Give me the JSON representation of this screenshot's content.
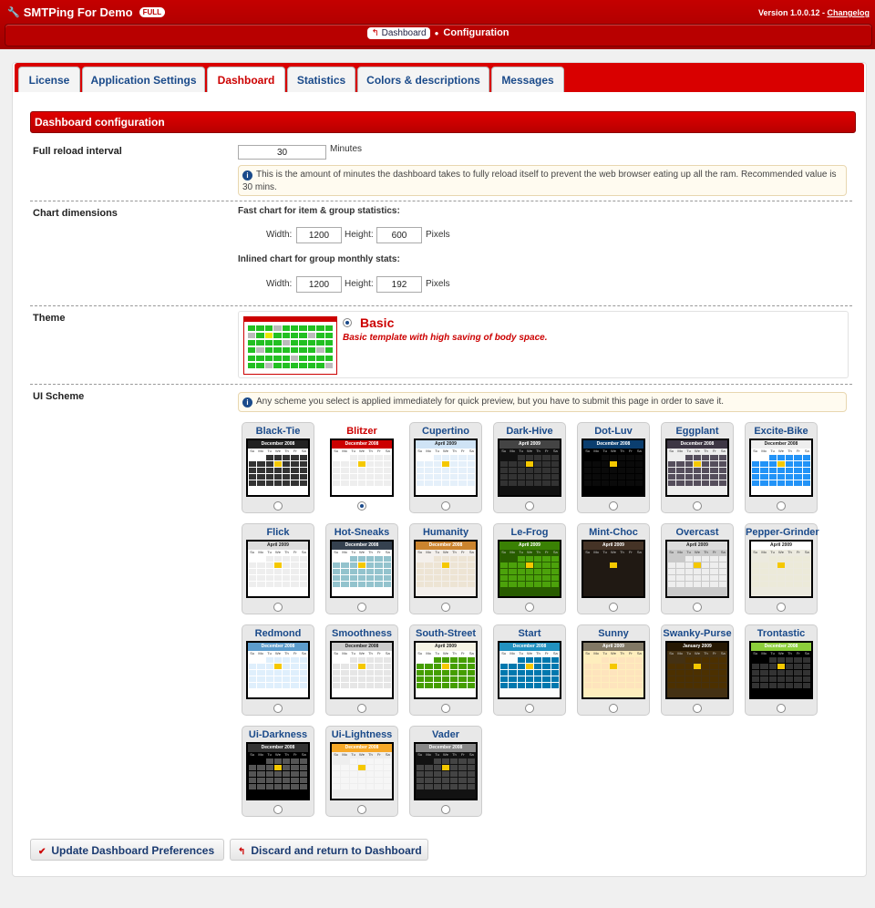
{
  "app": {
    "title": "SMTPing For Demo",
    "badge": "FULL",
    "version_text": "Version 1.0.0.12 - ",
    "changelog_label": "Changelog"
  },
  "breadcrumb": {
    "link_label": "Dashboard",
    "current_label": "Configuration"
  },
  "tabs": [
    {
      "label": "License",
      "active": false
    },
    {
      "label": "Application Settings",
      "active": false
    },
    {
      "label": "Dashboard",
      "active": true
    },
    {
      "label": "Statistics",
      "active": false
    },
    {
      "label": "Colors & descriptions",
      "active": false
    },
    {
      "label": "Messages",
      "active": false
    }
  ],
  "section": {
    "title": "Dashboard configuration"
  },
  "reload": {
    "label": "Full reload interval",
    "value": "30",
    "unit": "Minutes",
    "note": "This is the amount of minutes the dashboard takes to fully reload itself to prevent the web browser eating up all the ram. Recommended value is 30 mins."
  },
  "chart_dims": {
    "label": "Chart dimensions",
    "fast_label": "Fast chart for item & group statistics:",
    "fast_width": "1200",
    "fast_height": "600",
    "inline_label": "Inlined chart for group monthly stats:",
    "inline_width": "1200",
    "inline_height": "192",
    "width_label": "Width:",
    "height_label": "Height:",
    "unit": "Pixels"
  },
  "theme": {
    "label": "Theme",
    "name": "Basic",
    "description": "Basic template with high saving of body space."
  },
  "ui_scheme": {
    "label": "UI Scheme",
    "note": "Any scheme you select is applied immediately for quick preview, but you have to submit this page in order to save it.",
    "schemes": [
      {
        "name": "Black-Tie",
        "month": "December 2008",
        "head": "#222222",
        "cell": "#333333",
        "body": "#ffffff"
      },
      {
        "name": "Blitzer",
        "month": "December 2008",
        "head": "#cc0000",
        "cell": "#eeeeee",
        "body": "#ffffff",
        "selected": true
      },
      {
        "name": "Cupertino",
        "month": "April 2009",
        "head": "#cfe3f5",
        "cell": "#e5f0fa",
        "body": "#ffffff"
      },
      {
        "name": "Dark-Hive",
        "month": "April 2009",
        "head": "#444444",
        "cell": "#333333",
        "body": "#111111"
      },
      {
        "name": "Dot-Luv",
        "month": "December 2008",
        "head": "#0b3e6f",
        "cell": "#0a0a0a",
        "body": "#000000"
      },
      {
        "name": "Eggplant",
        "month": "December 2008",
        "head": "#3d3644",
        "cell": "#554e5c",
        "body": "#eeeeee"
      },
      {
        "name": "Excite-Bike",
        "month": "December 2008",
        "head": "#eeeeee",
        "cell": "#2293f7",
        "body": "#ffffff"
      },
      {
        "name": "Flick",
        "month": "April 2009",
        "head": "#dddddd",
        "cell": "#eeeeee",
        "body": "#ffffff"
      },
      {
        "name": "Hot-Sneaks",
        "month": "December 2008",
        "head": "#35414f",
        "cell": "#93c3cd",
        "body": "#ffffff"
      },
      {
        "name": "Humanity",
        "month": "December 2008",
        "head": "#cb842e",
        "cell": "#ede4d4",
        "body": "#f4f0ec"
      },
      {
        "name": "Le-Frog",
        "month": "April 2009",
        "head": "#3a8104",
        "cell": "#4ca20b",
        "body": "#285c00"
      },
      {
        "name": "Mint-Choc",
        "month": "April 2009",
        "head": "#453326",
        "cell": "#201913",
        "body": "#201913"
      },
      {
        "name": "Overcast",
        "month": "April 2009",
        "head": "#dddddd",
        "cell": "#eeeeee",
        "body": "#c9c9c9"
      },
      {
        "name": "Pepper-Grinder",
        "month": "April 2009",
        "head": "#ffffff",
        "cell": "#ecead9",
        "body": "#eceadf"
      },
      {
        "name": "Redmond",
        "month": "December 2008",
        "head": "#5c9ccc",
        "cell": "#dfeffc",
        "body": "#ffffff"
      },
      {
        "name": "Smoothness",
        "month": "December 2008",
        "head": "#cccccc",
        "cell": "#e6e6e6",
        "body": "#ffffff"
      },
      {
        "name": "South-Street",
        "month": "April 2009",
        "head": "#f5f3e5",
        "cell": "#459e00",
        "body": "#ffffff"
      },
      {
        "name": "Start",
        "month": "December 2008",
        "head": "#2191c0",
        "cell": "#0078ae",
        "body": "#fcfdfd"
      },
      {
        "name": "Sunny",
        "month": "April 2009",
        "head": "#817865",
        "cell": "#fee4bd",
        "body": "#feeebd"
      },
      {
        "name": "Swanky-Purse",
        "month": "January 2009",
        "head": "#261803",
        "cell": "#4c3000",
        "body": "#443113"
      },
      {
        "name": "Trontastic",
        "month": "December 2008",
        "head": "#8cce3b",
        "cell": "#333333",
        "body": "#000000"
      },
      {
        "name": "Ui-Darkness",
        "month": "December 2008",
        "head": "#333333",
        "cell": "#555555",
        "body": "#000000"
      },
      {
        "name": "Ui-Lightness",
        "month": "December 2008",
        "head": "#f6a828",
        "cell": "#f6f6f6",
        "body": "#eeeeee"
      },
      {
        "name": "Vader",
        "month": "December 2008",
        "head": "#888888",
        "cell": "#444444",
        "body": "#121212"
      }
    ]
  },
  "buttons": {
    "update_label": "Update Dashboard Preferences",
    "discard_label": "Discard and return to Dashboard"
  }
}
